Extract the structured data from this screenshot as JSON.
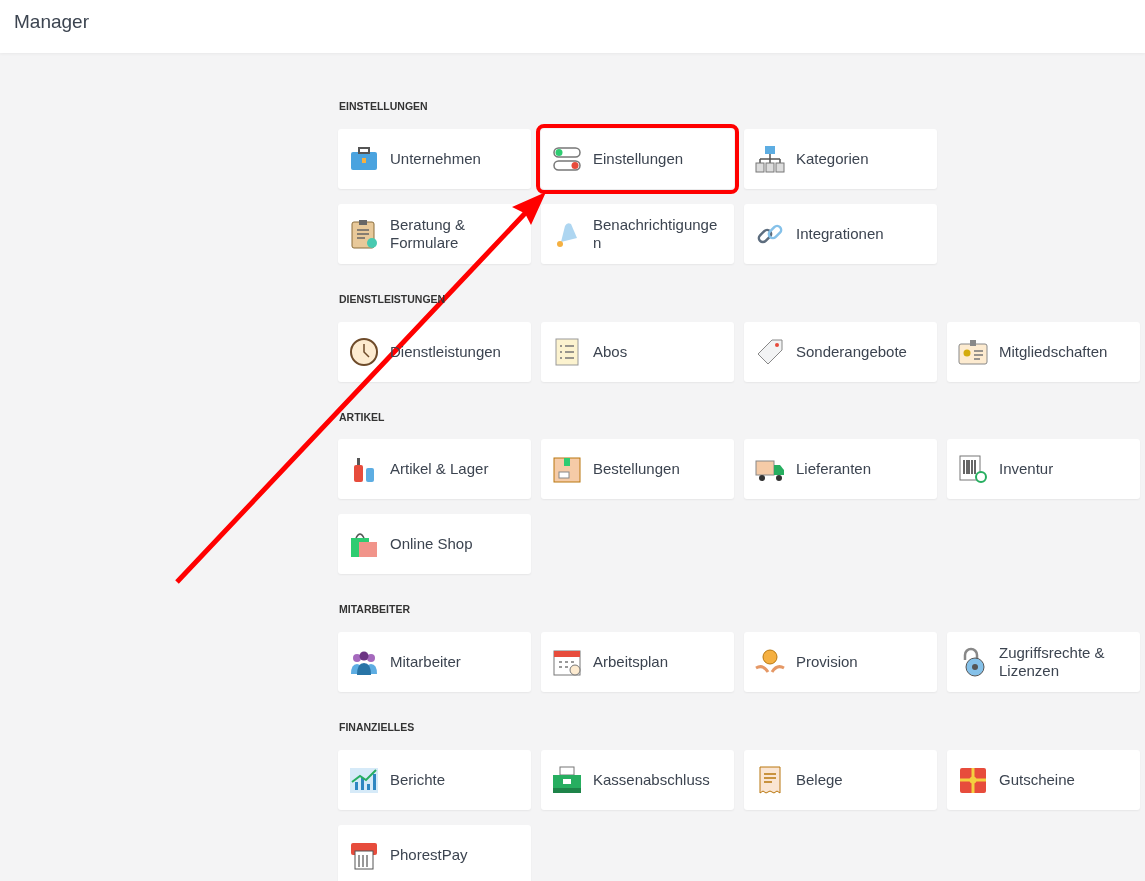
{
  "header": {
    "title": "Manager"
  },
  "sections": [
    {
      "title": "EINSTELLUNGEN",
      "rows": [
        [
          {
            "label": "Unternehmen",
            "highlighted": false
          },
          {
            "label": "Einstellungen",
            "highlighted": true
          },
          {
            "label": "Kategorien",
            "highlighted": false
          }
        ],
        [
          {
            "label": "Beratung & Formulare",
            "highlighted": false
          },
          {
            "label": "Benachrichtigungen",
            "highlighted": false
          },
          {
            "label": "Integrationen",
            "highlighted": false
          }
        ]
      ]
    },
    {
      "title": "DIENSTLEISTUNGEN",
      "rows": [
        [
          {
            "label": "Dienstleistungen",
            "highlighted": false
          },
          {
            "label": "Abos",
            "highlighted": false
          },
          {
            "label": "Sonderangebote",
            "highlighted": false
          },
          {
            "label": "Mitgliedschaften",
            "highlighted": false
          }
        ]
      ]
    },
    {
      "title": "ARTIKEL",
      "rows": [
        [
          {
            "label": "Artikel & Lager",
            "highlighted": false
          },
          {
            "label": "Bestellungen",
            "highlighted": false
          },
          {
            "label": "Lieferanten",
            "highlighted": false
          },
          {
            "label": "Inventur",
            "highlighted": false
          }
        ],
        [
          {
            "label": "Online Shop",
            "highlighted": false
          }
        ]
      ]
    },
    {
      "title": "MITARBEITER",
      "rows": [
        [
          {
            "label": "Mitarbeiter",
            "highlighted": false
          },
          {
            "label": "Arbeitsplan",
            "highlighted": false
          },
          {
            "label": "Provision",
            "highlighted": false
          },
          {
            "label": "Zugriffsrechte & Lizenzen",
            "highlighted": false
          }
        ]
      ]
    },
    {
      "title": "FINANZIELLES",
      "rows": [
        [
          {
            "label": "Berichte",
            "highlighted": false
          },
          {
            "label": "Kassenabschluss",
            "highlighted": false
          },
          {
            "label": "Belege",
            "highlighted": false
          },
          {
            "label": "Gutscheine",
            "highlighted": false
          }
        ],
        [
          {
            "label": "PhorestPay",
            "highlighted": false
          }
        ]
      ]
    }
  ],
  "annotation": {
    "arrow": true
  }
}
